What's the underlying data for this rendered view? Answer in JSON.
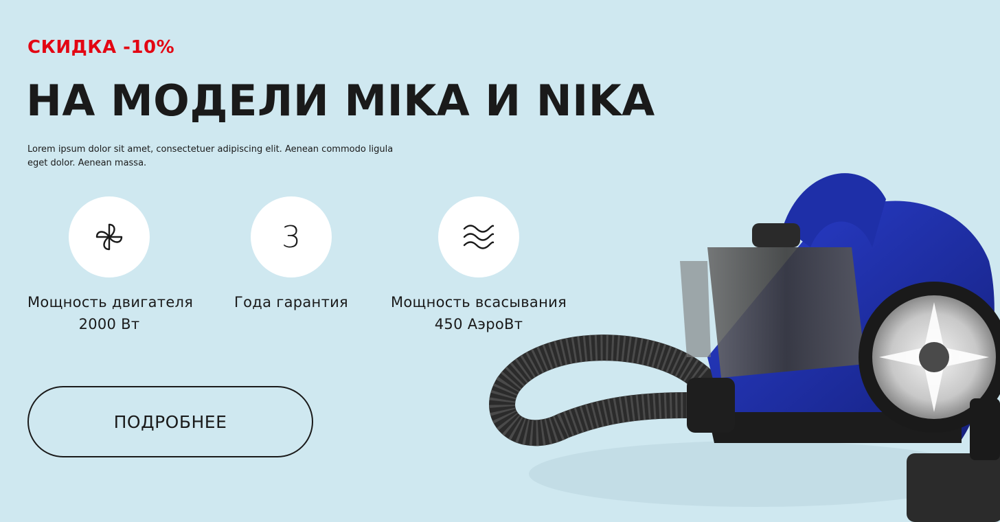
{
  "promo": {
    "discount": "СКИДКА -10%",
    "discount_color": "#e30613",
    "headline": "НА МОДЕЛИ MIKA И NIKA",
    "description": "Lorem ipsum dolor sit amet, consectetuer adipiscing elit. Aenean commodo ligula eget dolor. Aenean massa."
  },
  "features": [
    {
      "icon": "fan-icon",
      "line1": "Мощность двигателя",
      "line2": "2000 Вт"
    },
    {
      "icon": "number-3",
      "value": "3",
      "line1": "Года гарантия"
    },
    {
      "icon": "airflow-waves-icon",
      "line1": "Мощность всасывания",
      "line2": "450 АэроВт"
    }
  ],
  "cta": {
    "label": "ПОДРОБНЕЕ"
  },
  "colors": {
    "background": "#cfe8f0",
    "text": "#1a1a1a",
    "accent": "#e30613",
    "product_blue": "#1e2fa8"
  },
  "product_image": {
    "name": "vacuum-cleaner-image"
  }
}
